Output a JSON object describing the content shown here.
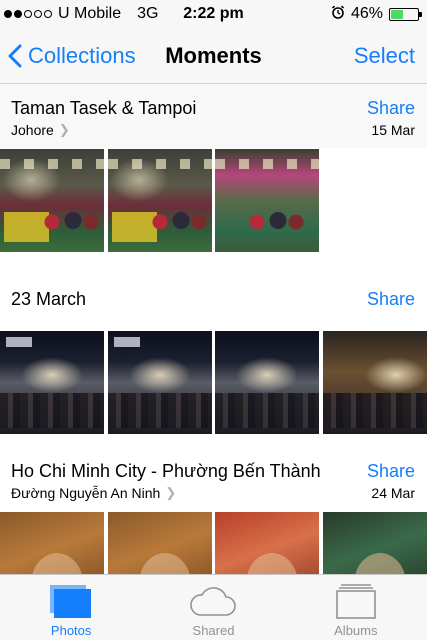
{
  "status_bar": {
    "carrier": "U Mobile",
    "network": "3G",
    "time": "2:22 pm",
    "battery_percent": "46%",
    "battery_level": 0.46,
    "signal_bars_filled": 2,
    "signal_bars_total": 5
  },
  "nav": {
    "back_label": "Collections",
    "title": "Moments",
    "select_label": "Select"
  },
  "moments": [
    {
      "title": "Taman Tasek & Tampoi",
      "location": "Johore",
      "date": "15 Mar",
      "share_label": "Share"
    },
    {
      "title": "23 March",
      "location": "",
      "date": "",
      "share_label": "Share"
    },
    {
      "title": "Ho Chi Minh City - Phường Bến Thành",
      "location": "Đường Nguyễn An Ninh",
      "date": "24 Mar",
      "share_label": "Share"
    }
  ],
  "tabs": [
    {
      "label": "Photos",
      "icon": "photos-icon",
      "active": true
    },
    {
      "label": "Shared",
      "icon": "cloud-icon",
      "active": false
    },
    {
      "label": "Albums",
      "icon": "albums-icon",
      "active": false
    }
  ],
  "colors": {
    "accent": "#157efb",
    "tab_inactive": "#929292",
    "battery": "#4cd964"
  }
}
